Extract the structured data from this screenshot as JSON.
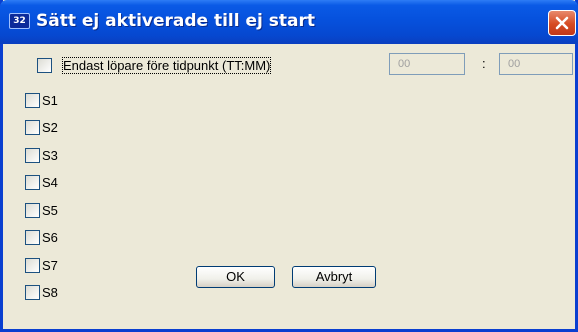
{
  "window": {
    "title": "Sätt ej aktiverade till ej start",
    "icon_text": "32",
    "icon": "app-icon",
    "close_icon": "close-icon",
    "accent": "#0651dd",
    "close_color": "#d64b22"
  },
  "filter": {
    "label": "Endast löpare före tidpunkt (TT:MM)",
    "checked": false,
    "hours": "00",
    "separator": ":",
    "minutes": "00"
  },
  "stations": [
    {
      "label": "S1",
      "checked": false
    },
    {
      "label": "S2",
      "checked": false
    },
    {
      "label": "S3",
      "checked": false
    },
    {
      "label": "S4",
      "checked": false
    },
    {
      "label": "S5",
      "checked": false
    },
    {
      "label": "S6",
      "checked": false
    },
    {
      "label": "S7",
      "checked": false
    },
    {
      "label": "S8",
      "checked": false
    }
  ],
  "buttons": {
    "ok": "OK",
    "cancel": "Avbryt"
  }
}
